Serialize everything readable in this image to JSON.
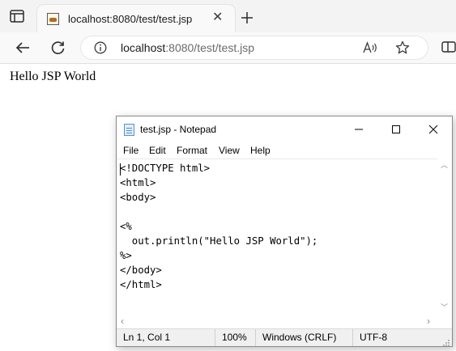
{
  "browser": {
    "tab": {
      "title": "localhost:8080/test/test.jsp",
      "close_glyph": "✕"
    },
    "new_tab_glyph": "+",
    "address": {
      "host": "localhost",
      "rest": ":8080/test/test.jsp"
    },
    "icons": {
      "tab_actions": "tab-actions-icon",
      "back": "back-arrow-icon",
      "refresh": "refresh-icon",
      "info": "info-icon",
      "read_aloud": "read-aloud-icon",
      "favorite": "star-icon",
      "split_screen": "split-screen-icon"
    }
  },
  "page": {
    "text": "Hello JSP World"
  },
  "notepad": {
    "title": "test.jsp - Notepad",
    "menu": [
      "File",
      "Edit",
      "Format",
      "View",
      "Help"
    ],
    "code_lines": [
      "<!DOCTYPE html>",
      "<html>",
      "<body>",
      "",
      "<%",
      "  out.println(\"Hello JSP World\");",
      "%>",
      "</body>",
      "</html>"
    ],
    "status": {
      "position": "Ln 1, Col 1",
      "zoom": "100%",
      "line_ending": "Windows (CRLF)",
      "encoding": "UTF-8"
    },
    "scroll_arrows": {
      "up": "︿",
      "down": "﹀",
      "left": "‹",
      "right": "›"
    }
  },
  "colors": {
    "tabstrip_bg": "#f3f3f3",
    "toolbar_bg": "#f9f9f9",
    "status_bg": "#f0f0f0"
  }
}
